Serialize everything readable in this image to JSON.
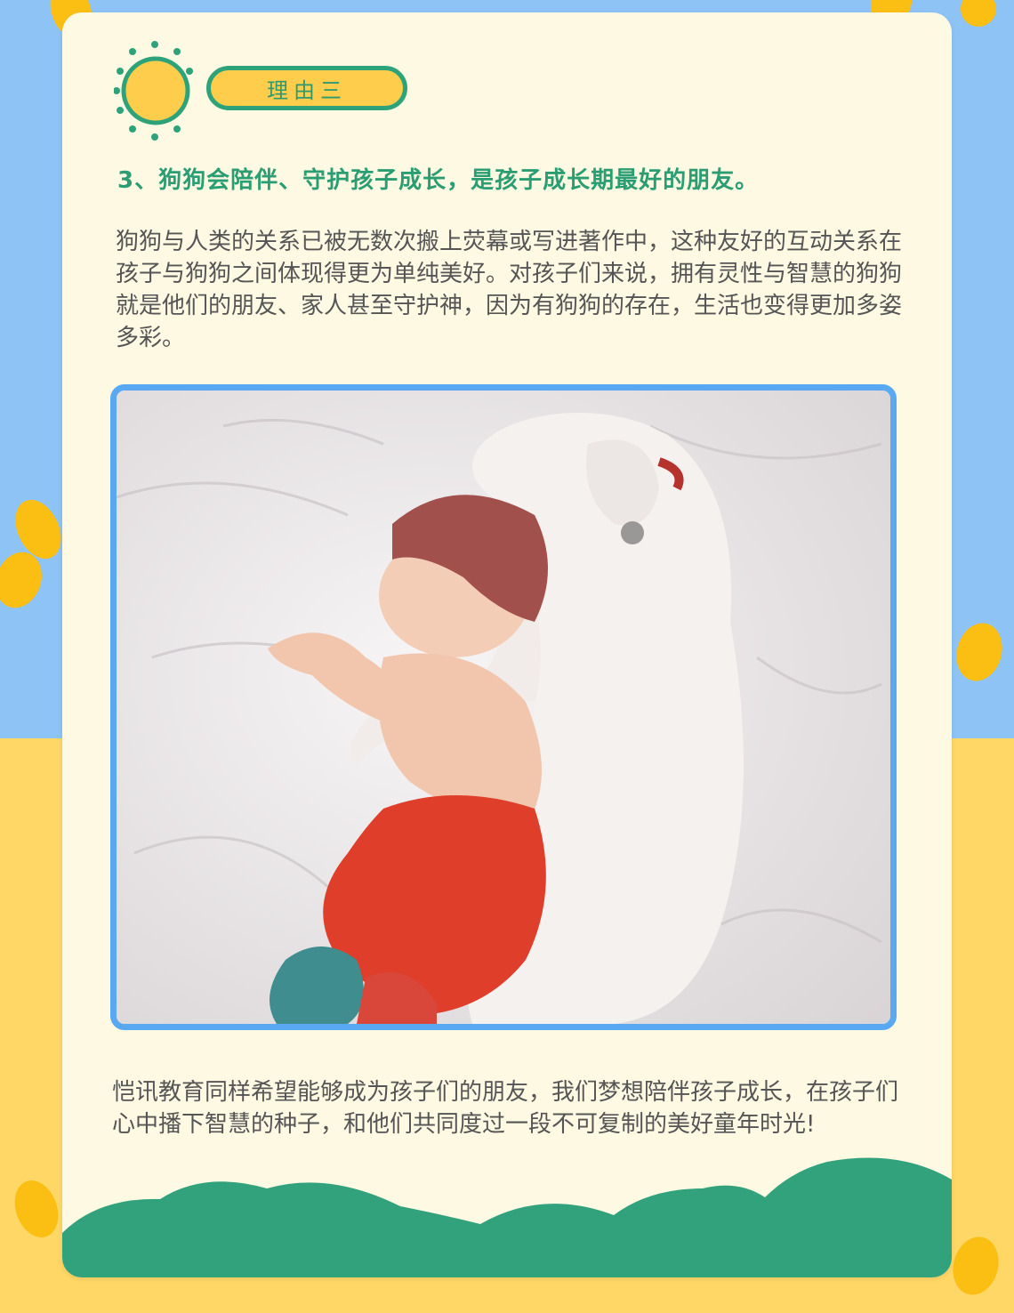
{
  "badge": {
    "label": "理由三"
  },
  "heading": "3、狗狗会陪伴、守护孩子成长，是孩子成长期最好的朋友。",
  "paragraph1": "狗狗与人类的关系已被无数次搬上荧幕或写进著作中，这种友好的互动关系在孩子与狗狗之间体现得更为单纯美好。对孩子们来说，拥有灵性与智慧的狗狗就是他们的朋友、家人甚至守护神，因为有狗狗的存在，生活也变得更加多姿多彩。",
  "paragraph2": "恺讯教育同样希望能够成为孩子们的朋友，我们梦想陪伴孩子成长，在孩子们心中播下智慧的种子，和他们共同度过一段不可复制的美好童年时光!",
  "colors": {
    "green": "#2a9d72",
    "yellow": "#fecd4c",
    "blue": "#8ec3f5",
    "photo_border": "#58a9f2",
    "card": "#fef9e3"
  },
  "icons": {
    "badge_icon": "sun-icon"
  }
}
